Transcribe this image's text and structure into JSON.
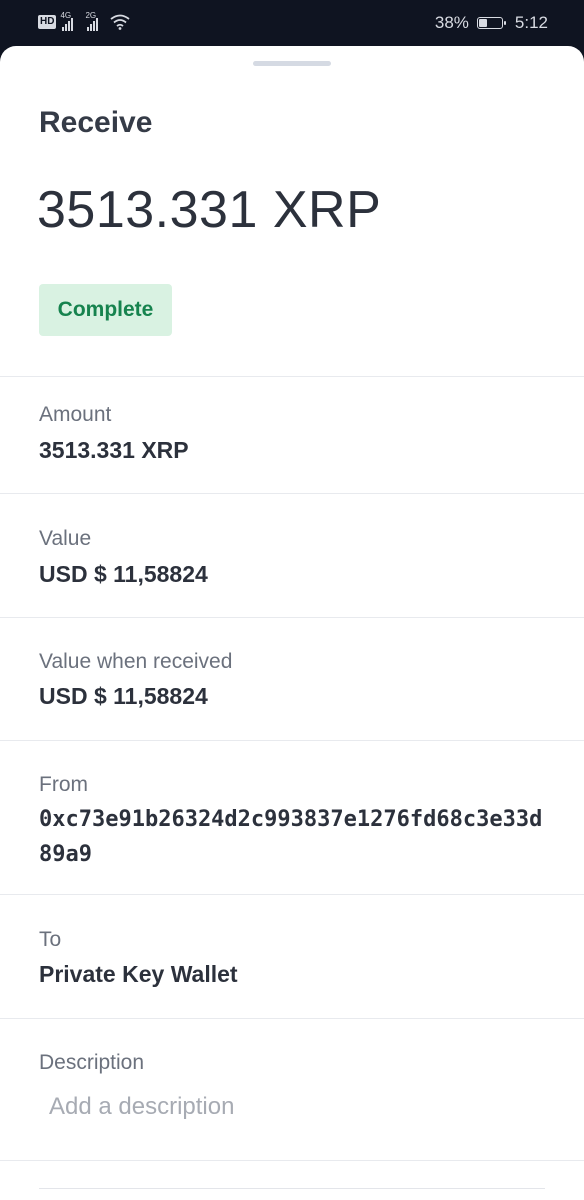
{
  "status_bar": {
    "hd": "HD",
    "net1": "4G",
    "net2": "2G",
    "battery_text": "38%",
    "battery_level": 0.38,
    "time": "5:12"
  },
  "sheet": {
    "title": "Receive",
    "amount": "3513.331 XRP",
    "status": "Complete",
    "status_color": "#16834e",
    "status_bg": "#d9f2e2"
  },
  "details": [
    {
      "label": "Amount",
      "value": "3513.331 XRP"
    },
    {
      "label": "Value",
      "value": "USD $ 11,58824"
    },
    {
      "label": "Value when received",
      "value": "USD $ 11,58824"
    },
    {
      "label": "From",
      "value": "0xc73e91b26324d2c993837e1276fd68c3e33d89a9"
    },
    {
      "label": "To",
      "value": "Private Key Wallet"
    }
  ],
  "description": {
    "label": "Description",
    "placeholder": "Add a description",
    "value": ""
  }
}
